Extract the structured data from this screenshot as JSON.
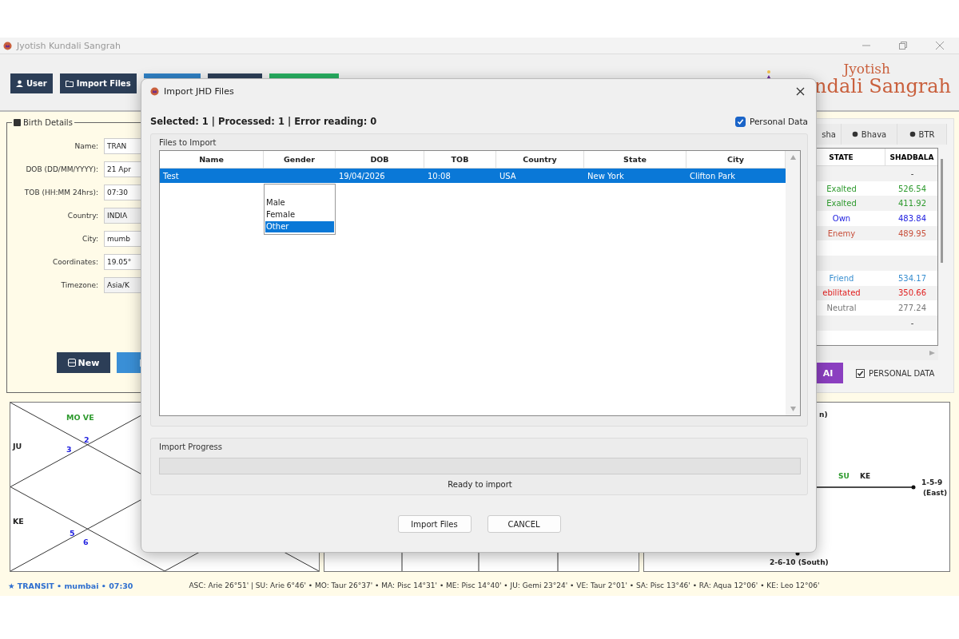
{
  "app": {
    "title": "Jyotish Kundali Sangrah"
  },
  "toolbar": {
    "buttons": [
      {
        "label": "User",
        "kind": "user"
      },
      {
        "label": "Import Files",
        "kind": "folder"
      }
    ],
    "stubs": [
      {
        "color": "#2f80c4"
      },
      {
        "color": "#2c3e57"
      },
      {
        "color": "#27ae60"
      }
    ]
  },
  "logo": {
    "line1": "Jyotish",
    "line2": "ndali Sangrah"
  },
  "birth_details": {
    "title": "Birth Details",
    "fields": [
      {
        "label": "Name:",
        "value": "TRAN"
      },
      {
        "label": "DOB (DD/MM/YYYY):",
        "value": "21 Apr"
      },
      {
        "label": "TOB (HH:MM 24hrs):",
        "value": "07:30"
      },
      {
        "label": "Country:",
        "value": "INDIA",
        "kind": "select"
      },
      {
        "label": "City:",
        "value": "mumb"
      },
      {
        "label": "Coordinates:",
        "value": "19.05°"
      },
      {
        "label": "Timezone:",
        "value": "Asia/K",
        "kind": "select"
      }
    ],
    "new_button": "New"
  },
  "right_panel": {
    "tabs": [
      {
        "label": "sha",
        "selected": false
      },
      {
        "label": "Bhava",
        "selected": false
      },
      {
        "label": "BTR",
        "selected": false
      }
    ],
    "columns": [
      "STATE",
      "SHADBALA"
    ],
    "rows": [
      {
        "shadbala": "-"
      },
      {
        "state": "Exalted",
        "shadbala": "526.54",
        "color": "#2e9a2e"
      },
      {
        "state": "Exalted",
        "shadbala": "411.92",
        "color": "#2e9a2e"
      },
      {
        "state": "Own",
        "shadbala": "483.84",
        "color": "#2323e0"
      },
      {
        "state": "Enemy",
        "shadbala": "489.95",
        "color": "#c8503c"
      },
      {},
      {},
      {
        "state": "Friend",
        "shadbala": "534.17",
        "color": "#3a8fd0"
      },
      {
        "state": "ebilitated",
        "shadbala": "350.66",
        "color": "#e02020"
      },
      {
        "state": "Neutral",
        "shadbala": "277.24",
        "color": "#777777"
      },
      {
        "shadbala": "-"
      },
      {}
    ],
    "ai_button": "AI",
    "personal_data": {
      "label": "PERSONAL DATA",
      "checked": true
    }
  },
  "left_chart": {
    "labels": [
      {
        "text": "MO VE",
        "color": "#2e9a2e"
      },
      {
        "text": "2",
        "color": "#2323e0"
      },
      {
        "text": "3",
        "color": "#2323e0"
      },
      {
        "text": "JU",
        "color": "#222222"
      },
      {
        "text": "KE",
        "color": "#222222"
      },
      {
        "text": "5",
        "color": "#2323e0"
      },
      {
        "text": "6",
        "color": "#2323e0"
      }
    ]
  },
  "right_chart": {
    "labels": [
      {
        "text": "n)",
        "color": "#222222"
      },
      {
        "text": "SU",
        "color": "#2e9a2e"
      },
      {
        "text": "KE",
        "color": "#222222"
      },
      {
        "text": "1-5-9",
        "color": "#222222"
      },
      {
        "text": "(East)",
        "color": "#222222"
      },
      {
        "text": "2-6-10 (South)",
        "color": "#222222"
      }
    ]
  },
  "status_bar": {
    "transit": "★ TRANSIT • mumbai • 07:30",
    "positions": "ASC: Arie 26°51'  |  SU: Arie 6°46'  •  MO: Taur 26°37'  •  MA: Pisc 14°31'  •  ME: Pisc 14°40'  •  JU: Gemi 23°24'  •  VE: Taur 2°01'  •  SA: Pisc 13°46'  •  RA: Aqua 12°06'  •  KE: Leo 12°06'"
  },
  "dialog": {
    "title": "Import JHD Files",
    "summary": "Selected: 1 | Processed: 1 | Error reading: 0",
    "personal_data": {
      "label": "Personal Data",
      "checked": true
    },
    "files_group": "Files to Import",
    "table": {
      "columns": [
        "Name",
        "Gender",
        "DOB",
        "TOB",
        "Country",
        "State",
        "City"
      ],
      "rows": [
        {
          "name": "Test",
          "dob": "19/04/2026",
          "tob": "10:08",
          "country": "USA",
          "state": "New York",
          "city": "Clifton Park",
          "selected": true
        }
      ]
    },
    "gender_options": [
      {
        "label": "Male",
        "selected": false
      },
      {
        "label": "Female",
        "selected": false
      },
      {
        "label": "Other",
        "selected": true
      }
    ],
    "progress": {
      "title": "Import Progress",
      "level": 0,
      "status": "Ready to import"
    },
    "buttons": [
      {
        "label": "Import Files"
      },
      {
        "label": "CANCEL"
      }
    ]
  }
}
